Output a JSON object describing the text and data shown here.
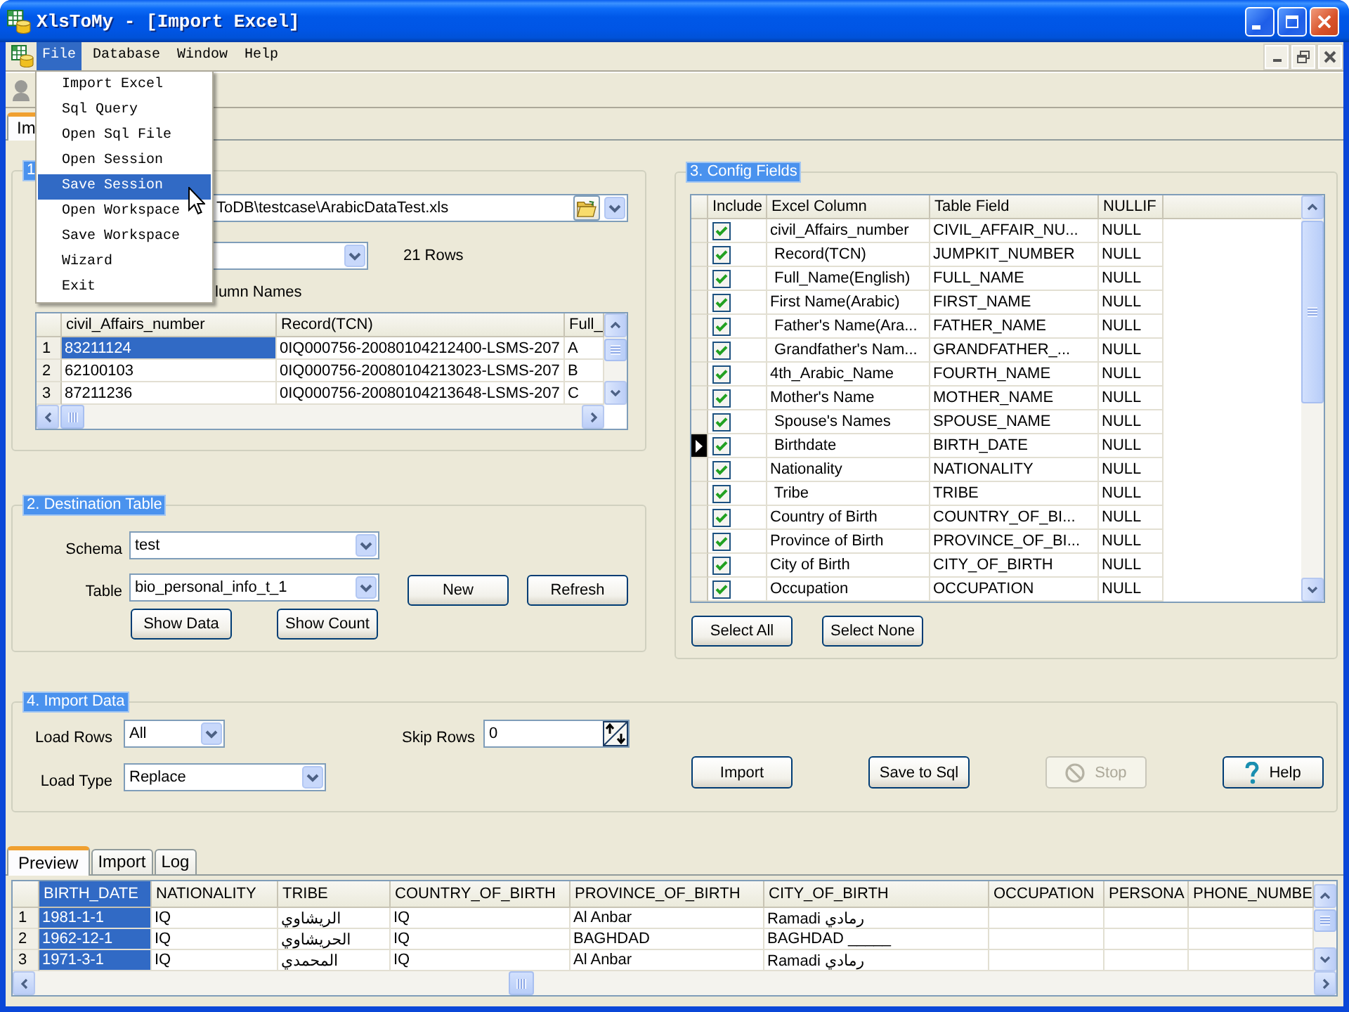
{
  "window": {
    "title": "XlsToMy - [Import Excel]"
  },
  "menu_bar": [
    {
      "label": "File",
      "selected": true
    },
    {
      "label": "Database",
      "selected": false
    },
    {
      "label": "Window",
      "selected": false
    },
    {
      "label": "Help",
      "selected": false
    }
  ],
  "file_menu": [
    {
      "label": "Import Excel",
      "selected": false
    },
    {
      "label": "Sql Query",
      "selected": false
    },
    {
      "label": "Open Sql File",
      "selected": false
    },
    {
      "label": "Open Session",
      "selected": false
    },
    {
      "label": "Save Session",
      "selected": true
    },
    {
      "label": "Open Workspace",
      "selected": false
    },
    {
      "label": "Save Workspace",
      "selected": false
    },
    {
      "label": "Wizard",
      "selected": false
    },
    {
      "label": "Exit",
      "selected": false
    }
  ],
  "document_tabs": [
    {
      "label": "Im",
      "selected": true
    }
  ],
  "source": {
    "legend": "1",
    "file_path": "ToDB\\testcase\\ArabicDataTest.xls",
    "row_count": "21 Rows",
    "header_option": "lumn Names",
    "columns": [
      "civil_Affairs_number",
      "Record(TCN)",
      "Full_"
    ],
    "rows": [
      {
        "number": "1",
        "cells": [
          {
            "text": "83211124",
            "selected": true
          },
          {
            "text": "0IQ000756-20080104212400-LSMS-207",
            "selected": false
          },
          {
            "text": "A",
            "selected": false
          }
        ]
      },
      {
        "number": "2",
        "cells": [
          {
            "text": "62100103",
            "selected": false
          },
          {
            "text": "0IQ000756-20080104213023-LSMS-207",
            "selected": false
          },
          {
            "text": "B",
            "selected": false
          }
        ]
      },
      {
        "number": "3",
        "cells": [
          {
            "text": "87211236",
            "selected": false
          },
          {
            "text": "0IQ000756-20080104213648-LSMS-207",
            "selected": false
          },
          {
            "text": "C",
            "selected": false
          }
        ]
      }
    ]
  },
  "destination": {
    "legend": "2. Destination Table",
    "schema_label": "Schema",
    "schema": "test",
    "table_label": "Table",
    "table": "bio_personal_info_t_1",
    "new_button": "New",
    "refresh_button": "Refresh",
    "show_data_button": "Show Data",
    "show_count_button": "Show Count"
  },
  "config": {
    "legend": "3. Config Fields",
    "columns": [
      "Include",
      "Excel Column",
      "Table Field",
      "NULLIF"
    ],
    "rows": [
      {
        "include": true,
        "selected": false,
        "excel_column": "civil_Affairs_number",
        "table_field": "CIVIL_AFFAIR_NU...",
        "nullif": "NULL"
      },
      {
        "include": true,
        "selected": false,
        "excel_column": " Record(TCN)",
        "table_field": "JUMPKIT_NUMBER",
        "nullif": "NULL"
      },
      {
        "include": true,
        "selected": false,
        "excel_column": " Full_Name(English)",
        "table_field": "FULL_NAME",
        "nullif": "NULL"
      },
      {
        "include": true,
        "selected": false,
        "excel_column": "First Name(Arabic)",
        "table_field": "FIRST_NAME",
        "nullif": "NULL"
      },
      {
        "include": true,
        "selected": false,
        "excel_column": " Father's Name(Ara...",
        "table_field": "FATHER_NAME",
        "nullif": "NULL"
      },
      {
        "include": true,
        "selected": false,
        "excel_column": " Grandfather's Nam...",
        "table_field": "GRANDFATHER_...",
        "nullif": "NULL"
      },
      {
        "include": true,
        "selected": false,
        "excel_column": "4th_Arabic_Name",
        "table_field": "FOURTH_NAME",
        "nullif": "NULL"
      },
      {
        "include": true,
        "selected": false,
        "excel_column": "Mother's Name",
        "table_field": "MOTHER_NAME",
        "nullif": "NULL"
      },
      {
        "include": true,
        "selected": false,
        "excel_column": " Spouse's Names",
        "table_field": "SPOUSE_NAME",
        "nullif": "NULL"
      },
      {
        "include": true,
        "selected": true,
        "excel_column": " Birthdate",
        "table_field": "BIRTH_DATE",
        "nullif": "NULL"
      },
      {
        "include": true,
        "selected": false,
        "excel_column": "Nationality",
        "table_field": "NATIONALITY",
        "nullif": "NULL"
      },
      {
        "include": true,
        "selected": false,
        "excel_column": " Tribe",
        "table_field": "TRIBE",
        "nullif": "NULL"
      },
      {
        "include": true,
        "selected": false,
        "excel_column": "Country of Birth",
        "table_field": "COUNTRY_OF_BI...",
        "nullif": "NULL"
      },
      {
        "include": true,
        "selected": false,
        "excel_column": "Province of Birth",
        "table_field": "PROVINCE_OF_BI...",
        "nullif": "NULL"
      },
      {
        "include": true,
        "selected": false,
        "excel_column": "City of Birth",
        "table_field": "CITY_OF_BIRTH",
        "nullif": "NULL"
      },
      {
        "include": true,
        "selected": false,
        "excel_column": "Occupation",
        "table_field": "OCCUPATION",
        "nullif": "NULL"
      }
    ],
    "buttons": [
      "Select All",
      "Select None"
    ]
  },
  "import": {
    "legend": "4. Import Data",
    "load_rows_label": "Load Rows",
    "load_rows": "All",
    "load_type_label": "Load Type",
    "load_type": "Replace",
    "skip_rows_label": "Skip Rows",
    "skip_rows": "0",
    "buttons": [
      {
        "label": "Import",
        "kind": "plain",
        "disabled": false
      },
      {
        "label": "Save to Sql",
        "kind": "plain",
        "disabled": false
      },
      {
        "label": "Stop",
        "kind": "stop",
        "disabled": true
      },
      {
        "label": "Help",
        "kind": "help",
        "disabled": false
      }
    ]
  },
  "result_tabs": [
    {
      "label": "Preview",
      "selected": true
    },
    {
      "label": "Import",
      "selected": false
    },
    {
      "label": "Log",
      "selected": false
    }
  ],
  "preview": {
    "columns": [
      {
        "label": "BIRTH_DATE",
        "selected": true
      },
      {
        "label": "NATIONALITY",
        "selected": false
      },
      {
        "label": "TRIBE",
        "selected": false
      },
      {
        "label": "COUNTRY_OF_BIRTH",
        "selected": false
      },
      {
        "label": "PROVINCE_OF_BIRTH",
        "selected": false
      },
      {
        "label": "CITY_OF_BIRTH",
        "selected": false
      },
      {
        "label": "OCCUPATION",
        "selected": false
      },
      {
        "label": "PERSONA",
        "selected": false
      },
      {
        "label": "PHONE_NUMBE",
        "selected": false
      }
    ],
    "rows": [
      {
        "number": "1",
        "cells": [
          "1981-1-1",
          "IQ",
          "الريشاوي",
          "IQ",
          "Al Anbar",
          "Ramadi رمادي"
        ]
      },
      {
        "number": "2",
        "cells": [
          "1962-12-1",
          "IQ",
          "الحريشاوي",
          "IQ",
          "BAGHDAD",
          "BAGHDAD _____"
        ]
      },
      {
        "number": "3",
        "cells": [
          "1971-3-1",
          "IQ",
          "المحمدي",
          "IQ",
          "Al Anbar",
          "Ramadi رمادي"
        ]
      }
    ]
  }
}
